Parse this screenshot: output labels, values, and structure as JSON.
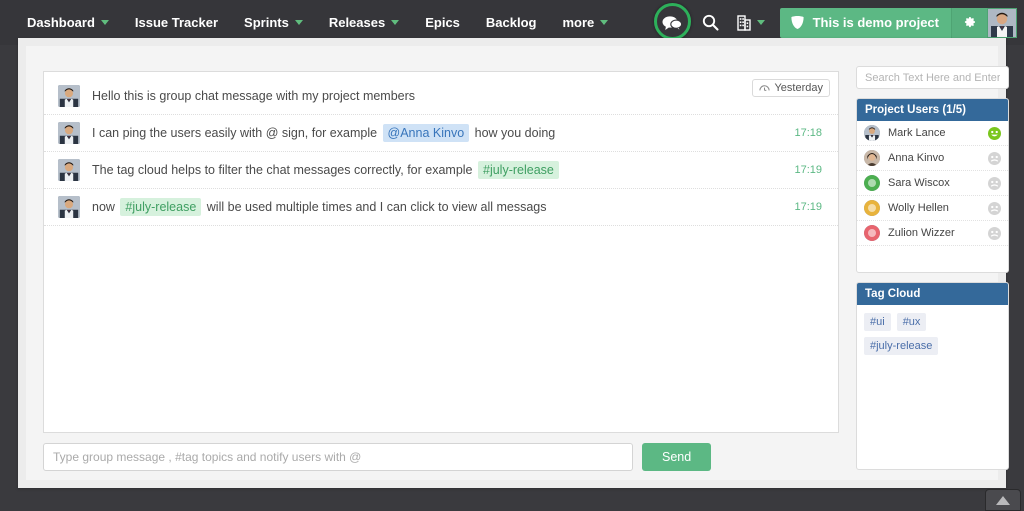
{
  "nav": {
    "items": [
      {
        "label": "Dashboard",
        "caret": true
      },
      {
        "label": "Issue Tracker",
        "caret": false
      },
      {
        "label": "Sprints",
        "caret": true
      },
      {
        "label": "Releases",
        "caret": true
      },
      {
        "label": "Epics",
        "caret": false
      },
      {
        "label": "Backlog",
        "caret": false
      },
      {
        "label": "more",
        "caret": true
      }
    ],
    "chat_icon": "chat-bubbles-icon",
    "search_icon": "search-icon",
    "building_icon": "building-icon",
    "project_label": "This is demo project",
    "project_icon": "shield-icon",
    "gear_icon": "gear-icon",
    "avatar_icon": "user-avatar"
  },
  "chat": {
    "date_badge": "Yesterday",
    "date_badge_icon": "history-clock-icon",
    "messages": [
      {
        "avatar": "user-avatar",
        "parts": [
          {
            "type": "text",
            "value": "Hello this is group chat message with my project members"
          }
        ],
        "time": ""
      },
      {
        "avatar": "user-avatar",
        "parts": [
          {
            "type": "text",
            "value": "I can ping the users easily with @ sign, for example"
          },
          {
            "type": "mention",
            "value": "@Anna Kinvo"
          },
          {
            "type": "text",
            "value": "how you doing"
          }
        ],
        "time": "17:18"
      },
      {
        "avatar": "user-avatar",
        "parts": [
          {
            "type": "text",
            "value": "The tag cloud helps to filter the chat messages correctly, for example"
          },
          {
            "type": "tag",
            "value": "#july-release"
          }
        ],
        "time": "17:19"
      },
      {
        "avatar": "user-avatar",
        "parts": [
          {
            "type": "text",
            "value": "now"
          },
          {
            "type": "tag",
            "value": "#july-release"
          },
          {
            "type": "text",
            "value": "will be used multiple times and I can click to view all messags"
          }
        ],
        "time": "17:19"
      }
    ],
    "compose_placeholder": "Type group message , #tag topics and notify users with @",
    "send_label": "Send"
  },
  "sidebar": {
    "search_placeholder": "Search Text Here and Enter..",
    "users_panel": {
      "title": "Project Users (1/5)",
      "users": [
        {
          "name": "Mark Lance",
          "avatar_type": "photo",
          "avatar_color": "#5c6b7e",
          "online": true
        },
        {
          "name": "Anna Kinvo",
          "avatar_type": "photo",
          "avatar_color": "#3b3229",
          "online": false
        },
        {
          "name": "Sara Wiscox",
          "avatar_type": "circle",
          "avatar_color": "#4caf50",
          "online": false
        },
        {
          "name": "Wolly Hellen",
          "avatar_type": "circle",
          "avatar_color": "#e8b33c",
          "online": false
        },
        {
          "name": "Zulion Wizzer",
          "avatar_type": "circle",
          "avatar_color": "#e8646e",
          "online": false
        }
      ]
    },
    "tag_panel": {
      "title": "Tag Cloud",
      "tags": [
        "#ui",
        "#ux",
        "#july-release"
      ]
    }
  },
  "scroll_top": {
    "icon": "chevron-up-icon"
  },
  "colors": {
    "nav_bg": "#36363a",
    "accent_green": "#5cb884",
    "panel_head_blue": "#34699a",
    "mention_bg": "#cfe2f6",
    "mention_fg": "#3875bb",
    "tag_bg": "#d6f1dd",
    "tag_fg": "#3f9f62",
    "time_green": "#5cb884"
  }
}
